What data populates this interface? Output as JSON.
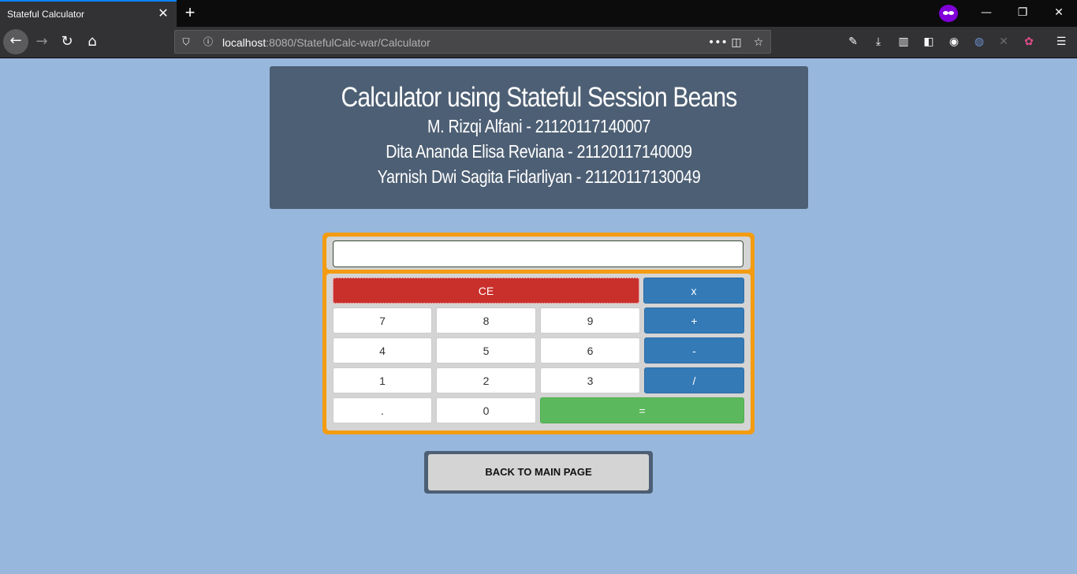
{
  "browser": {
    "tab_title": "Stateful Calculator",
    "tab_close": "✕",
    "new_tab": "+",
    "window": {
      "minimize": "—",
      "restore": "❐",
      "close": "✕"
    },
    "url_host": "localhost",
    "url_path": ":8080/StatefulCalc-war/Calculator",
    "url_more": "•••"
  },
  "header": {
    "title": "Calculator using Stateful Session Beans",
    "members": [
      "M. Rizqi Alfani - 21120117140007",
      "Dita Ananda Elisa Reviana - 21120117140009",
      "Yarnish Dwi Sagita Fidarliyan - 21120117130049"
    ]
  },
  "calculator": {
    "display_value": "",
    "keys": {
      "ce": "CE",
      "multiply": "x",
      "add": "+",
      "subtract": "-",
      "divide": "/",
      "equals": "=",
      "seven": "7",
      "eight": "8",
      "nine": "9",
      "four": "4",
      "five": "5",
      "six": "6",
      "one": "1",
      "two": "2",
      "three": "3",
      "dot": ".",
      "zero": "0"
    }
  },
  "back_button": "BACK TO MAIN PAGE",
  "colors": {
    "page_bg": "#98b7dc",
    "header_bg": "#4d5f74",
    "calc_border": "#f39c12",
    "ce_red": "#c9302c",
    "op_blue": "#337ab7",
    "equals_green": "#5cb85c"
  }
}
